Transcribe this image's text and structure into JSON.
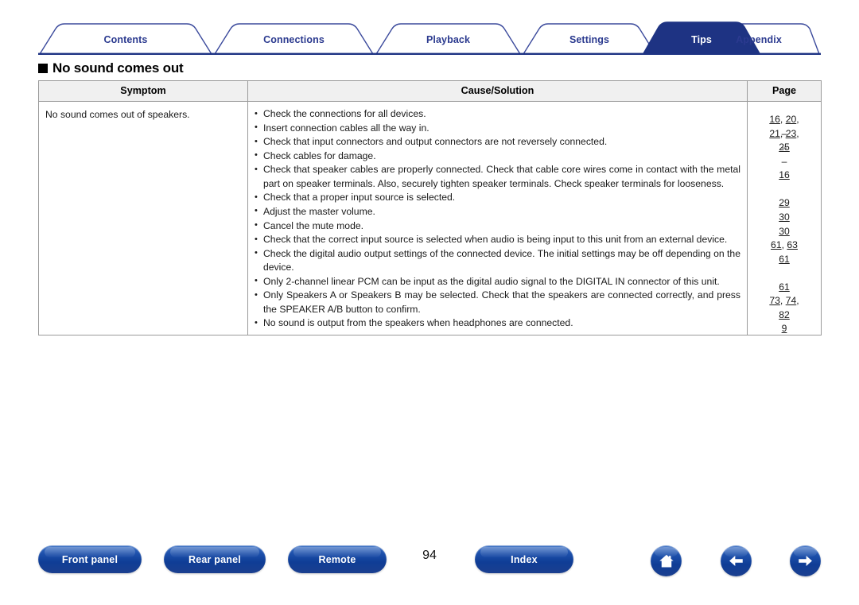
{
  "tabs": [
    {
      "label": "Contents",
      "active": false
    },
    {
      "label": "Connections",
      "active": false
    },
    {
      "label": "Playback",
      "active": false
    },
    {
      "label": "Settings",
      "active": false
    },
    {
      "label": "Tips",
      "active": true
    },
    {
      "label": "Appendix",
      "active": false
    }
  ],
  "section": {
    "heading": "No sound comes out"
  },
  "table": {
    "headers": [
      "Symptom",
      "Cause/Solution",
      "Page"
    ],
    "rows": [
      {
        "symptom": "No sound comes out of speakers.",
        "items": [
          {
            "text": "Check the connections for all devices.",
            "pages": [
              "16, 20,",
              "21, 23,",
              "25"
            ]
          },
          {
            "text": "Insert connection cables all the way in.",
            "pages": [
              "–"
            ]
          },
          {
            "text": "Check that input connectors and output connectors are not reversely connected.",
            "pages": [
              "–"
            ]
          },
          {
            "text": "Check cables for damage.",
            "pages": [
              "–"
            ]
          },
          {
            "text": "Check that speaker cables are properly connected. Check that cable core wires come in contact with the metal part on speaker terminals. Also, securely tighten speaker terminals. Check speaker terminals for looseness.",
            "pages": [
              "16"
            ]
          },
          {
            "text": "Check that a proper input source is selected.",
            "pages": [
              "29"
            ]
          },
          {
            "text": "Adjust the master volume.",
            "pages": [
              "30"
            ]
          },
          {
            "text": "Cancel the mute mode.",
            "pages": [
              "30"
            ]
          },
          {
            "text": "Check that the correct input source is selected when audio is being input to this unit from an external device.",
            "pages": [
              "61, 63"
            ]
          },
          {
            "text": "Check the digital audio output settings of the connected device. The initial settings may be off depending on the device.",
            "pages": [
              "61"
            ]
          },
          {
            "text": "Only 2-channel linear PCM can be input as the digital audio signal to the DIGITAL IN connector of this unit.",
            "pages": [
              "61"
            ]
          },
          {
            "text": "Only Speakers A or Speakers B may be selected. Check that the speakers are connected correctly, and press the SPEAKER A/B button to confirm.",
            "pages": [
              "73, 74,",
              "82"
            ]
          },
          {
            "text": "No sound is output from the speakers when headphones are connected.",
            "pages": [
              "9"
            ]
          }
        ]
      }
    ]
  },
  "footer": {
    "buttons": [
      {
        "label": "Front panel"
      },
      {
        "label": "Rear panel"
      },
      {
        "label": "Remote"
      },
      {
        "label": "Index"
      }
    ],
    "page_number": "94",
    "icons": [
      {
        "name": "home-icon"
      },
      {
        "name": "arrow-left-icon"
      },
      {
        "name": "arrow-right-icon"
      }
    ]
  },
  "colors": {
    "tab_active_fill": "#1e3383",
    "tab_border": "#2b3a8f",
    "tab_text": "#2b3a8f",
    "button_blue": "#1d50ab",
    "table_header_bg": "#f0f0f0",
    "table_border": "#9a9a9a"
  }
}
